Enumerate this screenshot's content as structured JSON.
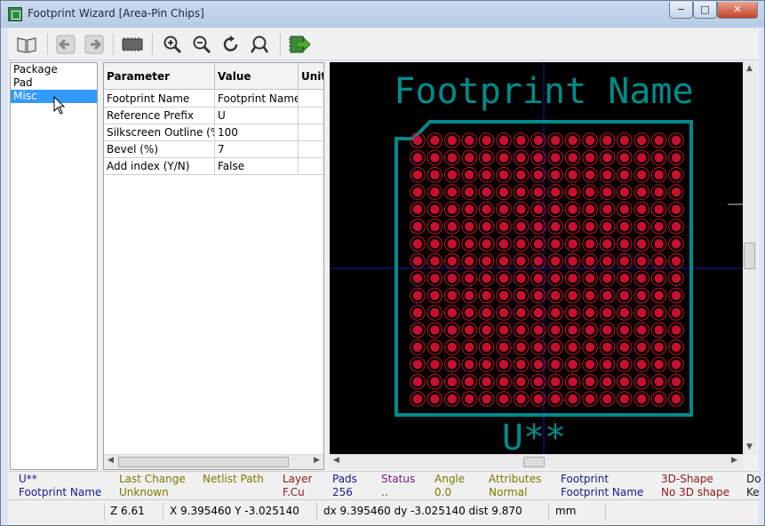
{
  "window": {
    "title": "Footprint Wizard [Area-Pin Chips]",
    "min_label": "−",
    "max_label": "□",
    "close_label": "✕"
  },
  "toolbar": {
    "items": [
      "open-library-icon",
      "previous-icon",
      "next-icon",
      "footprint-icon",
      "zoom-in-icon",
      "zoom-out-icon",
      "redraw-icon",
      "zoom-fit-icon",
      "export-footprint-icon"
    ]
  },
  "pages": {
    "items": [
      "Package",
      "Pad",
      "Misc"
    ],
    "selected": "Misc"
  },
  "params": {
    "headers": {
      "param": "Parameter",
      "value": "Value",
      "units": "Units"
    },
    "rows": [
      {
        "param": "Footprint Name",
        "value": "Footprint Name"
      },
      {
        "param": "Reference Prefix",
        "value": "U"
      },
      {
        "param": "Silkscreen Outline (%)",
        "value": "100"
      },
      {
        "param": "Bevel (%)",
        "value": "7"
      },
      {
        "param": "Add index (Y/N)",
        "value": "False"
      }
    ]
  },
  "preview": {
    "value_text": "Footprint Name",
    "reference_text": "U**",
    "silk_color": "#008b8b",
    "pad_color": "#c8102e",
    "pad_rows": 16,
    "pad_cols": 16
  },
  "msg_panel": {
    "ref": "U**",
    "value": "Footprint Name",
    "last_change_label": "Last Change",
    "last_change": "Unknown",
    "netlist_label": "Netlist Path",
    "netlist": "",
    "layer_label": "Layer",
    "layer": "F.Cu",
    "pads_label": "Pads",
    "pads": "256",
    "status_label": "Status",
    "status": "..",
    "angle_label": "Angle",
    "angle": "0.0",
    "attributes_label": "Attributes",
    "attributes": "Normal",
    "footprint_label": "Footprint",
    "footprint": "Footprint Name",
    "shape3d_label": "3D-Shape",
    "shape3d": "No 3D shape",
    "doc_label": "Do",
    "doc": "Ke"
  },
  "status": {
    "zoom": "Z 6.61",
    "xy": "X 9.395460  Y -3.025140",
    "delta": "dx 9.395460  dy -3.025140  dist 9.870",
    "units": "mm"
  }
}
